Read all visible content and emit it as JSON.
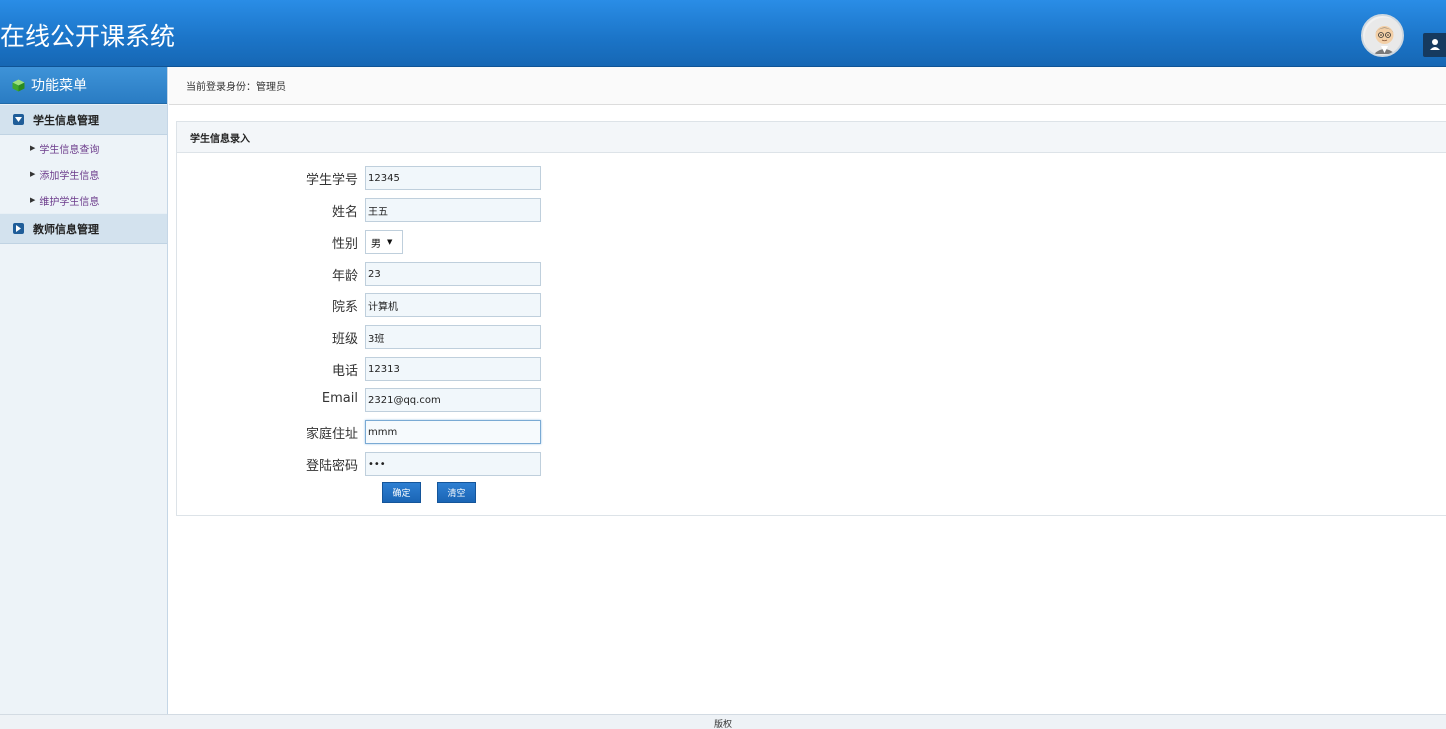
{
  "header": {
    "title": "在线公开课系统"
  },
  "sidebar": {
    "title": "功能菜单",
    "groups": [
      {
        "label": "学生信息管理",
        "items": [
          "学生信息查询",
          "添加学生信息",
          "维护学生信息"
        ]
      },
      {
        "label": "教师信息管理",
        "items": []
      }
    ]
  },
  "breadcrumb": {
    "text": "当前登录身份：管理员"
  },
  "form": {
    "title": "学生信息录入",
    "fields": [
      {
        "label": "学生学号",
        "value": "12345"
      },
      {
        "label": "姓名",
        "value": "王五"
      },
      {
        "label": "性别",
        "value": "男"
      },
      {
        "label": "年龄",
        "value": "23"
      },
      {
        "label": "院系",
        "value": "计算机"
      },
      {
        "label": "班级",
        "value": "3班"
      },
      {
        "label": "电话",
        "value": "12313"
      },
      {
        "label": "Email",
        "value": "2321@qq.com"
      },
      {
        "label": "家庭住址",
        "value": "mmm"
      },
      {
        "label": "登陆密码",
        "value": "•••"
      }
    ],
    "submit_label": "确定",
    "reset_label": "清空"
  },
  "footer": {
    "text": "版权"
  },
  "colors": {
    "header": "#1b74c7",
    "button": "#1f6dbf",
    "sidebar": "#edf3f8"
  }
}
